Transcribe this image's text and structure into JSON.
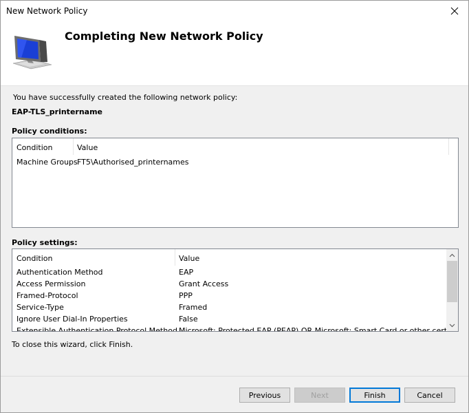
{
  "window": {
    "title": "New Network Policy"
  },
  "header": {
    "heading": "Completing New Network Policy",
    "icon": "computer-monitor-icon"
  },
  "intro_text": "You have successfully created the following network policy:",
  "policy_name": "EAP-TLS_printername",
  "conditions": {
    "label": "Policy conditions:",
    "columns": [
      "Condition",
      "Value"
    ],
    "rows": [
      {
        "condition": "Machine Groups",
        "value": "FT5\\Authorised_printernames"
      }
    ]
  },
  "settings": {
    "label": "Policy settings:",
    "columns": [
      "Condition",
      "Value"
    ],
    "rows": [
      {
        "condition": "Authentication Method",
        "value": "EAP"
      },
      {
        "condition": "Access Permission",
        "value": "Grant Access"
      },
      {
        "condition": "Framed-Protocol",
        "value": "PPP"
      },
      {
        "condition": "Service-Type",
        "value": "Framed"
      },
      {
        "condition": "Ignore User Dial-In Properties",
        "value": "False"
      },
      {
        "condition": "Extensible Authentication Protocol Method",
        "value": "Microsoft: Protected EAP (PEAP) OR Microsoft: Smart Card or other certificate"
      }
    ]
  },
  "close_hint": "To close this wizard, click Finish.",
  "buttons": {
    "previous": "Previous",
    "next": "Next",
    "finish": "Finish",
    "cancel": "Cancel"
  }
}
